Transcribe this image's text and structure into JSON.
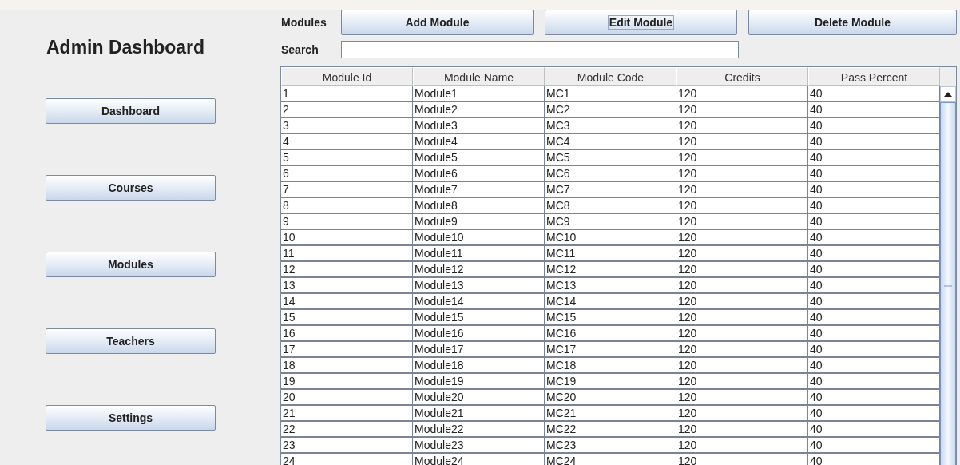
{
  "title": "Admin Dashboard",
  "nav": [
    {
      "label": "Dashboard"
    },
    {
      "label": "Courses"
    },
    {
      "label": "Modules"
    },
    {
      "label": "Teachers"
    },
    {
      "label": "Settings"
    }
  ],
  "toolbar": {
    "label": "Modules",
    "buttons": [
      {
        "label": "Add Module",
        "focused": false
      },
      {
        "label": "Edit Module",
        "focused": true
      },
      {
        "label": "Delete Module",
        "focused": false
      }
    ]
  },
  "search": {
    "label": "Search"
  },
  "table": {
    "columns": [
      "Module Id",
      "Module Name",
      "Module Code",
      "Credits",
      "Pass Percent"
    ],
    "rows": [
      [
        "1",
        "Module1",
        "MC1",
        "120",
        "40"
      ],
      [
        "2",
        "Module2",
        "MC2",
        "120",
        "40"
      ],
      [
        "3",
        "Module3",
        "MC3",
        "120",
        "40"
      ],
      [
        "4",
        "Module4",
        "MC4",
        "120",
        "40"
      ],
      [
        "5",
        "Module5",
        "MC5",
        "120",
        "40"
      ],
      [
        "6",
        "Module6",
        "MC6",
        "120",
        "40"
      ],
      [
        "7",
        "Module7",
        "MC7",
        "120",
        "40"
      ],
      [
        "8",
        "Module8",
        "MC8",
        "120",
        "40"
      ],
      [
        "9",
        "Module9",
        "MC9",
        "120",
        "40"
      ],
      [
        "10",
        "Module10",
        "MC10",
        "120",
        "40"
      ],
      [
        "11",
        "Module11",
        "MC11",
        "120",
        "40"
      ],
      [
        "12",
        "Module12",
        "MC12",
        "120",
        "40"
      ],
      [
        "13",
        "Module13",
        "MC13",
        "120",
        "40"
      ],
      [
        "14",
        "Module14",
        "MC14",
        "120",
        "40"
      ],
      [
        "15",
        "Module15",
        "MC15",
        "120",
        "40"
      ],
      [
        "16",
        "Module16",
        "MC16",
        "120",
        "40"
      ],
      [
        "17",
        "Module17",
        "MC17",
        "120",
        "40"
      ],
      [
        "18",
        "Module18",
        "MC18",
        "120",
        "40"
      ],
      [
        "19",
        "Module19",
        "MC19",
        "120",
        "40"
      ],
      [
        "20",
        "Module20",
        "MC20",
        "120",
        "40"
      ],
      [
        "21",
        "Module21",
        "MC21",
        "120",
        "40"
      ],
      [
        "22",
        "Module22",
        "MC22",
        "120",
        "40"
      ],
      [
        "23",
        "Module23",
        "MC23",
        "120",
        "40"
      ],
      [
        "24",
        "Module24",
        "MC24",
        "120",
        "40"
      ]
    ]
  }
}
